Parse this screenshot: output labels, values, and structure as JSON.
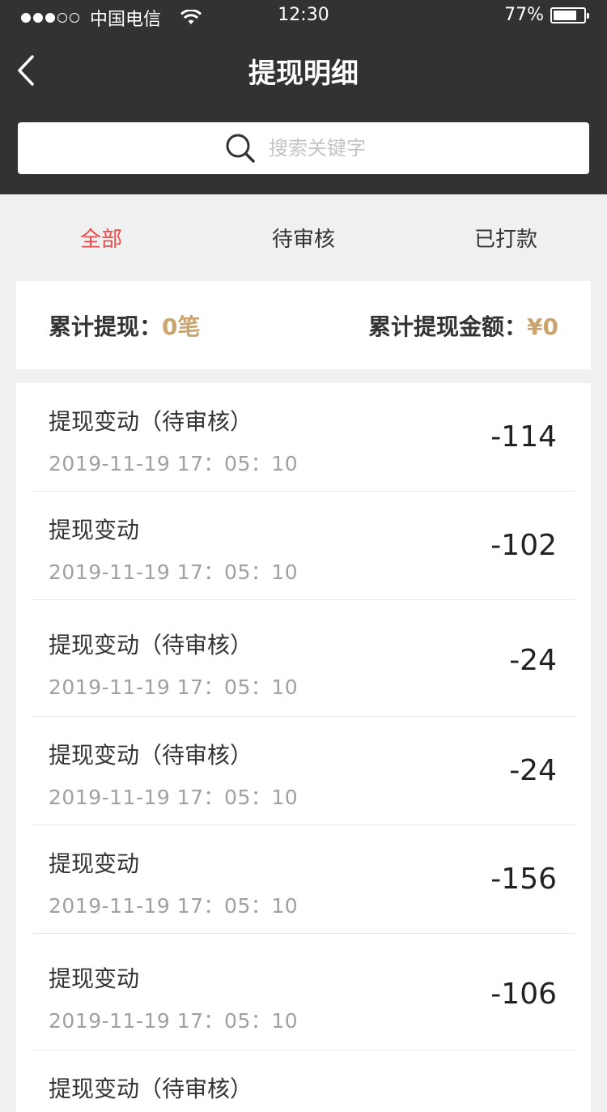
{
  "status_bar": {
    "carrier": "中国电信",
    "time": "12:30",
    "battery": "77%",
    "battery_level": 0.77
  },
  "header": {
    "title": "提现明细",
    "search_placeholder": "搜索关键字"
  },
  "tabs": [
    {
      "label": "全部",
      "active": true
    },
    {
      "label": "待审核",
      "active": false
    },
    {
      "label": "已打款",
      "active": false
    }
  ],
  "summary": {
    "count_label": "累计提现：",
    "count_value": "0笔",
    "amount_label": "累计提现金额：",
    "amount_value": "¥0"
  },
  "records": [
    {
      "name": "提现变动（待审核）",
      "date": "2019-11-19 17：05：10",
      "amount": "-114"
    },
    {
      "name": "提现变动",
      "date": "2019-11-19 17：05：10",
      "amount": "-102"
    },
    {
      "name": "提现变动（待审核）",
      "date": "2019-11-19 17：05：10",
      "amount": "-24"
    },
    {
      "name": "提现变动（待审核）",
      "date": "2019-11-19 17：05：10",
      "amount": "-24"
    },
    {
      "name": "提现变动",
      "date": "2019-11-19 17：05：10",
      "amount": "-156"
    },
    {
      "name": "提现变动",
      "date": "2019-11-19 17：05：10",
      "amount": "-106"
    },
    {
      "name": "提现变动（待审核）",
      "date": "",
      "amount": ""
    }
  ],
  "colors": {
    "header_bg": "#323232",
    "active_tab": "#ee4b4b",
    "summary_value": "#c9a46f"
  }
}
